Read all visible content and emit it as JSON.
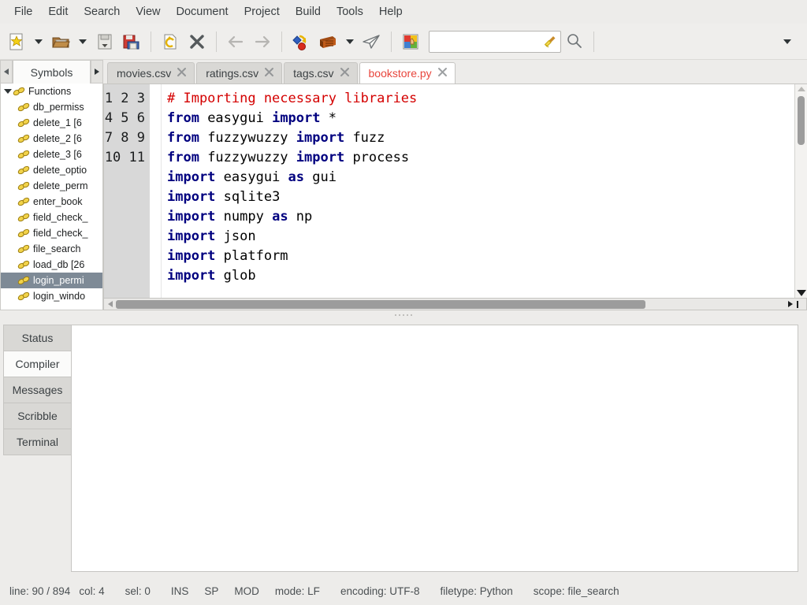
{
  "menubar": {
    "items": [
      {
        "label": "File"
      },
      {
        "label": "Edit"
      },
      {
        "label": "Search"
      },
      {
        "label": "View"
      },
      {
        "label": "Document"
      },
      {
        "label": "Project"
      },
      {
        "label": "Build"
      },
      {
        "label": "Tools"
      },
      {
        "label": "Help"
      }
    ]
  },
  "toolbar": {
    "new_file": "new-file-icon",
    "new_file_menu": "chevron-down-icon",
    "open_file": "open-folder-icon",
    "open_file_menu": "chevron-down-icon",
    "save": "save-icon",
    "save_all": "save-all-icon",
    "revert": "revert-icon",
    "close_file": "close-document-icon",
    "back": "navigate-back-icon",
    "forward": "navigate-forward-icon",
    "compile": "compile-icon",
    "build": "build-icon",
    "build_menu": "chevron-down-icon",
    "run": "run-icon",
    "color_chooser": "color-chooser-icon",
    "search_placeholder": "",
    "search_value": "",
    "search_clear": "clear-broom-icon",
    "find_icon": "magnifier-icon",
    "overflow": "toolbar-overflow-icon"
  },
  "sidebar": {
    "tab_label": "Symbols",
    "scroll_left": "scroll-left-icon",
    "scroll_right": "scroll-right-icon",
    "tree": {
      "root": "Functions",
      "items": [
        {
          "label": "db_permiss"
        },
        {
          "label": "delete_1 [6"
        },
        {
          "label": "delete_2 [6"
        },
        {
          "label": "delete_3 [6"
        },
        {
          "label": "delete_optio"
        },
        {
          "label": "delete_perm"
        },
        {
          "label": "enter_book"
        },
        {
          "label": "field_check_"
        },
        {
          "label": "field_check_"
        },
        {
          "label": "file_search "
        },
        {
          "label": "load_db [26"
        },
        {
          "label": "login_permi",
          "selected": true
        },
        {
          "label": "login_windo"
        }
      ]
    }
  },
  "editor": {
    "tabs": [
      {
        "label": "movies.csv",
        "active": false,
        "close": "close-icon"
      },
      {
        "label": "ratings.csv",
        "active": false,
        "close": "close-icon"
      },
      {
        "label": "tags.csv",
        "active": false,
        "close": "close-icon"
      },
      {
        "label": "bookstore.py",
        "active": true,
        "close": "close-icon"
      }
    ],
    "active_tab_color": "#e8453c",
    "line_numbers": [
      "1",
      "2",
      "3",
      "4",
      "5",
      "6",
      "7",
      "8",
      "9",
      "10",
      "11"
    ],
    "lines": [
      {
        "n": "1",
        "tokens": [
          {
            "t": "# Importing necessary libraries",
            "c": "cm"
          }
        ]
      },
      {
        "n": "2",
        "tokens": [
          {
            "t": "from",
            "c": "k"
          },
          {
            "t": " easygui ",
            "c": "op"
          },
          {
            "t": "import",
            "c": "k"
          },
          {
            "t": " *",
            "c": "op"
          }
        ]
      },
      {
        "n": "3",
        "tokens": [
          {
            "t": "from",
            "c": "k"
          },
          {
            "t": " fuzzywuzzy ",
            "c": "op"
          },
          {
            "t": "import",
            "c": "k"
          },
          {
            "t": " fuzz",
            "c": "op"
          }
        ]
      },
      {
        "n": "4",
        "tokens": [
          {
            "t": "from",
            "c": "k"
          },
          {
            "t": " fuzzywuzzy ",
            "c": "op"
          },
          {
            "t": "import",
            "c": "k"
          },
          {
            "t": " process",
            "c": "op"
          }
        ]
      },
      {
        "n": "5",
        "tokens": [
          {
            "t": "import",
            "c": "k"
          },
          {
            "t": " easygui ",
            "c": "op"
          },
          {
            "t": "as",
            "c": "k"
          },
          {
            "t": " gui",
            "c": "op"
          }
        ]
      },
      {
        "n": "6",
        "tokens": [
          {
            "t": "import",
            "c": "k"
          },
          {
            "t": " sqlite3",
            "c": "op"
          }
        ]
      },
      {
        "n": "7",
        "tokens": [
          {
            "t": "import",
            "c": "k"
          },
          {
            "t": " numpy ",
            "c": "op"
          },
          {
            "t": "as",
            "c": "k"
          },
          {
            "t": " np",
            "c": "op"
          }
        ]
      },
      {
        "n": "8",
        "tokens": [
          {
            "t": "import",
            "c": "k"
          },
          {
            "t": " json",
            "c": "op"
          }
        ]
      },
      {
        "n": "9",
        "tokens": [
          {
            "t": "import",
            "c": "k"
          },
          {
            "t": " platform",
            "c": "op"
          }
        ]
      },
      {
        "n": "10",
        "tokens": [
          {
            "t": "import",
            "c": "k"
          },
          {
            "t": " glob",
            "c": "op"
          }
        ]
      },
      {
        "n": "11",
        "tokens": []
      }
    ],
    "vscroll": "vertical-scrollbar",
    "hscroll": "horizontal-scrollbar"
  },
  "messages": {
    "tabs": [
      {
        "label": "Status",
        "active": false
      },
      {
        "label": "Compiler",
        "active": true
      },
      {
        "label": "Messages",
        "active": false
      },
      {
        "label": "Scribble",
        "active": false
      },
      {
        "label": "Terminal",
        "active": false
      }
    ],
    "content": ""
  },
  "statusbar": {
    "line": "line: 90 / 894",
    "col": "col: 4",
    "sel": "sel: 0",
    "ins": "INS",
    "sp": "SP",
    "mod": "MOD",
    "mode": "mode: LF",
    "encoding": "encoding: UTF-8",
    "filetype": "filetype: Python",
    "scope": "scope: file_search"
  }
}
